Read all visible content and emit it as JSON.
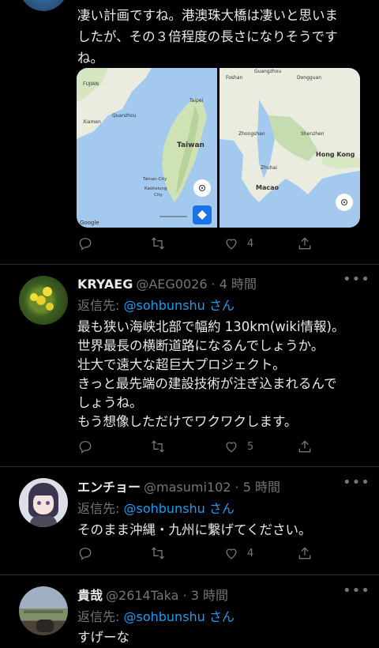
{
  "tweet0": {
    "text": "凄い計画ですね。港澳珠大橋は凄いと思いま\nしたが、その３倍程度の長さになりそうです\nね。",
    "map1": {
      "labels": [
        "Taiwan",
        "Taipei",
        "Quanzhou",
        "Xiamen",
        "Tainan City",
        "Kaohsiung City",
        "Google",
        "FUJIAN"
      ]
    },
    "map2": {
      "labels": [
        "Hong Kong",
        "Macao",
        "Shenzhen",
        "Dongguan",
        "Zhongshan",
        "Zhuhai",
        "Foshan",
        "Guangzhou"
      ]
    },
    "actions": {
      "reply": "",
      "retweet": "",
      "like": "4"
    }
  },
  "tweet1": {
    "name": "KRYAEG",
    "meta": "@AEG0026 · 4 時間",
    "reply_prefix": "返信先: ",
    "reply_handle": "@sohbunshu",
    "reply_suffix": " さん",
    "text": "最も狭い海峡北部で幅約 130km(wiki情報)。\n世界最長の横断道路になるんでしょうか。\n壮大で遠大な超巨大プロジェクト。\nきっと最先端の建設技術が注ぎ込まれるんで\nしょうね。\nもう想像しただけでワクワクします。",
    "actions": {
      "like": "5"
    }
  },
  "tweet2": {
    "name": "エンチョー",
    "meta": "@masumi102 · 5 時間",
    "reply_prefix": "返信先: ",
    "reply_handle": "@sohbunshu",
    "reply_suffix": " さん",
    "text": "そのまま沖縄・九州に繋げてください。",
    "actions": {
      "like": "4"
    }
  },
  "tweet3": {
    "name": "貴哉",
    "meta": "@2614Taka · 3 時間",
    "reply_prefix": "返信先: ",
    "reply_handle": "@sohbunshu",
    "reply_suffix": " さん",
    "text": "すげーな"
  },
  "colors": {
    "background": "#000000",
    "link": "#1d9bf0",
    "muted": "#71767b",
    "text": "#e7e9ea",
    "divider": "#2f3336"
  }
}
